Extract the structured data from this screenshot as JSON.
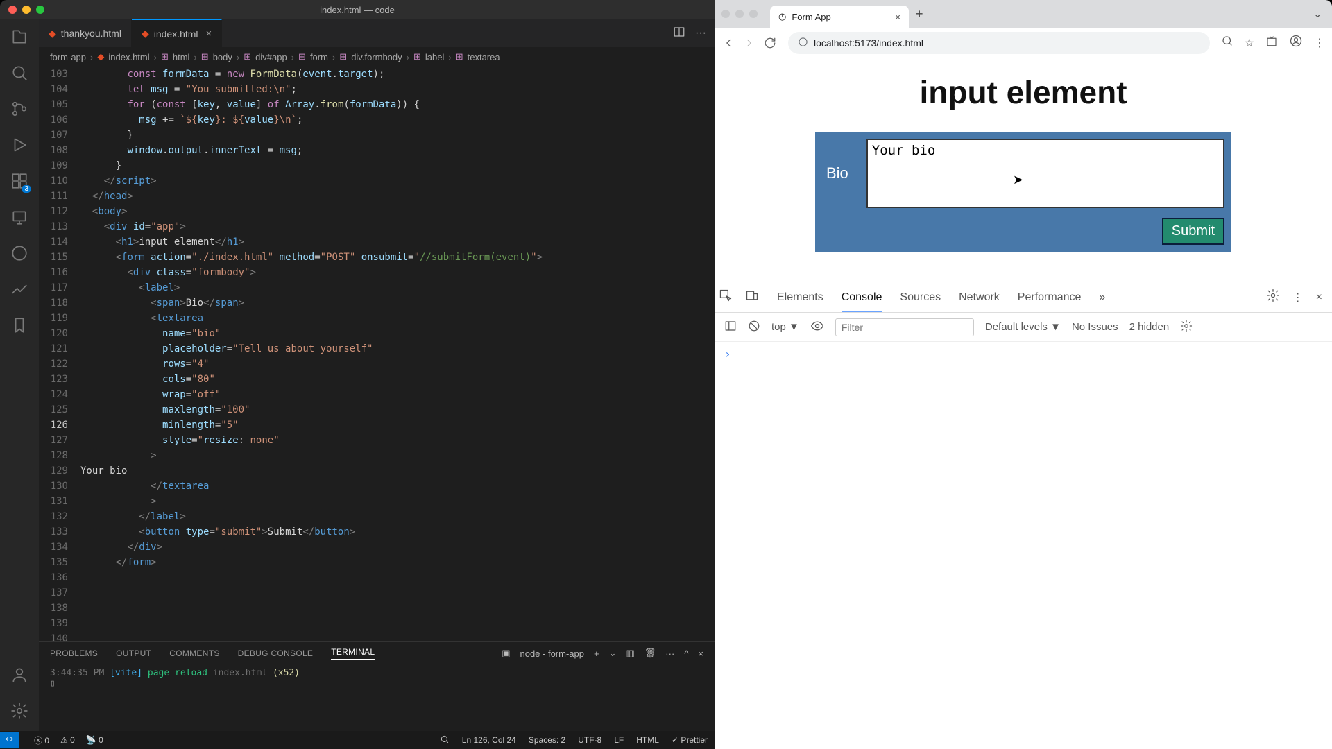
{
  "vscode": {
    "title": "index.html — code",
    "tabs": [
      {
        "label": "thankyou.html",
        "active": false
      },
      {
        "label": "index.html",
        "active": true
      }
    ],
    "breadcrumb": [
      "form-app",
      "index.html",
      "html",
      "body",
      "div#app",
      "form",
      "div.formbody",
      "label",
      "textarea"
    ],
    "lineStart": 103,
    "currentLine": 126,
    "ext_badge": "3",
    "panel": {
      "tabs": [
        "PROBLEMS",
        "OUTPUT",
        "COMMENTS",
        "DEBUG CONSOLE",
        "TERMINAL"
      ],
      "active": "TERMINAL",
      "task": "node - form-app",
      "log_time": "3:44:35 PM",
      "log_vite": "[vite]",
      "log_msg": "page reload",
      "log_file": "index.html",
      "log_count": "(x52)"
    },
    "status": {
      "errors": "0",
      "warnings": "0",
      "ports": "0",
      "ln": "Ln 126, Col 24",
      "spaces": "Spaces: 2",
      "enc": "UTF-8",
      "eol": "LF",
      "lang": "HTML",
      "prettier": "Prettier"
    }
  },
  "browser": {
    "tab_title": "Form App",
    "url": "localhost:5173/index.html",
    "page": {
      "heading": "input element",
      "field_label": "Bio",
      "textarea_value": "Your bio",
      "submit_label": "Submit"
    },
    "devtools": {
      "tabs": [
        "Elements",
        "Console",
        "Sources",
        "Network",
        "Performance"
      ],
      "active": "Console",
      "context": "top",
      "filter_placeholder": "Filter",
      "levels": "Default levels",
      "issues": "No Issues",
      "hidden": "2 hidden"
    }
  }
}
